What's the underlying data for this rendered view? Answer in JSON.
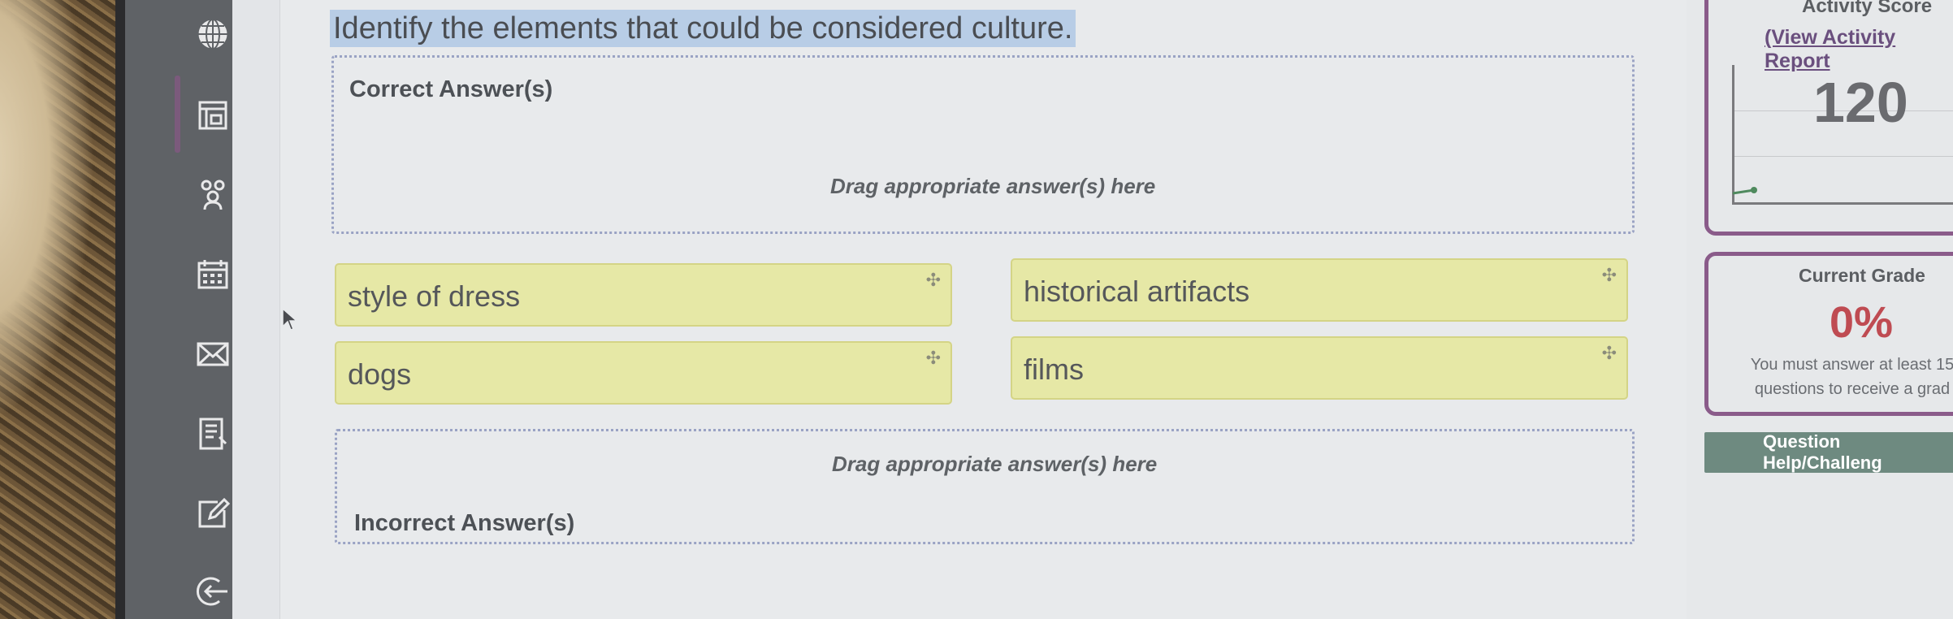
{
  "question": {
    "text": "Identify the elements that could be considered culture."
  },
  "correct_zone": {
    "title": "Correct Answer(s)",
    "hint": "Drag appropriate answer(s) here"
  },
  "incorrect_zone": {
    "title": "Incorrect Answer(s)",
    "hint": "Drag appropriate answer(s) here"
  },
  "answers": [
    {
      "label": "style of dress"
    },
    {
      "label": "historical artifacts"
    },
    {
      "label": "dogs"
    },
    {
      "label": "films"
    }
  ],
  "move_glyph": "✣",
  "sidebar": {
    "icons": [
      "globe-icon",
      "dashboard-icon",
      "people-icon",
      "calendar-icon",
      "mail-icon",
      "notes-icon",
      "edit-icon",
      "logout-icon"
    ]
  },
  "activity_score": {
    "heading": "Activity Score",
    "link": "(View Activity Report",
    "value": "120"
  },
  "current_grade": {
    "title": "Current Grade",
    "value": "0%",
    "message_line1": "You must answer at least 15",
    "message_line2": "questions to receive a grad"
  },
  "help_button": {
    "label": "Question Help/Challeng"
  },
  "colors": {
    "accent_purple": "#8a5b8a",
    "grade_red": "#bf4b52",
    "help_green": "#6e8a80",
    "tile_yellow": "#e6e8a6",
    "question_highlight": "#b8cde6"
  }
}
